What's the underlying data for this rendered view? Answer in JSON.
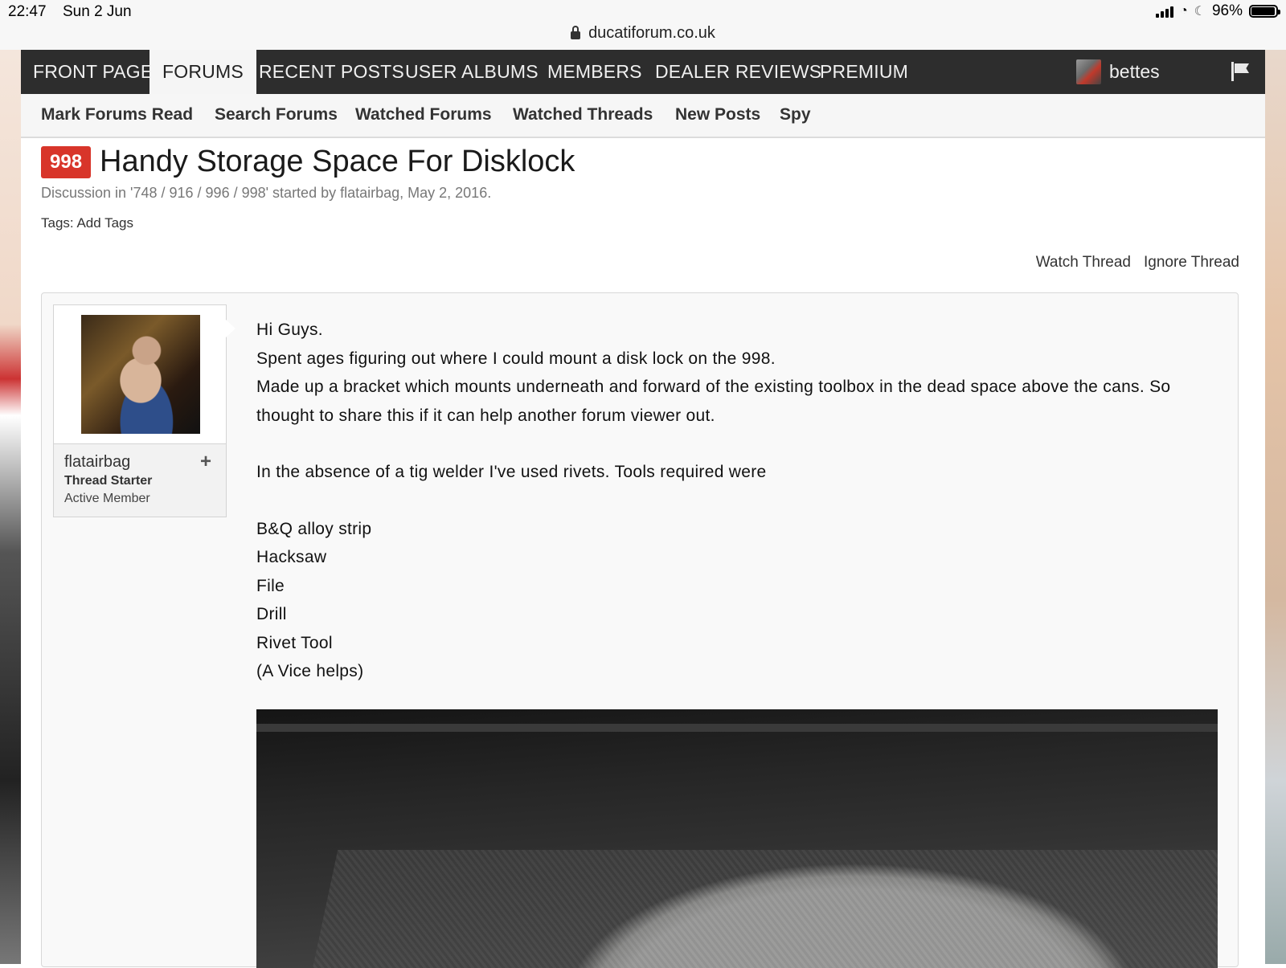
{
  "status_bar": {
    "time": "22:47",
    "date": "Sun 2 Jun",
    "battery": "96%"
  },
  "address_bar": {
    "url": "ducatiforum.co.uk"
  },
  "main_nav": {
    "tabs": [
      {
        "label": "FRONT PAGE"
      },
      {
        "label": "FORUMS"
      },
      {
        "label": "RECENT POSTS"
      },
      {
        "label": "USER ALBUMS"
      },
      {
        "label": "MEMBERS"
      },
      {
        "label": "DEALER REVIEWS"
      },
      {
        "label": "PREMIUM"
      }
    ],
    "active_tab": "FORUMS",
    "username": "bettes"
  },
  "sub_nav": {
    "links": [
      {
        "label": "Mark Forums Read"
      },
      {
        "label": "Search Forums"
      },
      {
        "label": "Watched Forums"
      },
      {
        "label": "Watched Threads"
      },
      {
        "label": "New Posts"
      },
      {
        "label": "Spy"
      }
    ]
  },
  "thread": {
    "prefix": "998",
    "title": "Handy Storage Space For Disklock",
    "meta": "Discussion in '748 / 916 / 996 / 998' started by flatairbag, May 2, 2016.",
    "tags_label": "Tags:",
    "add_tags": "Add Tags",
    "watch": "Watch Thread",
    "ignore": "Ignore Thread"
  },
  "post": {
    "author": "flatairbag",
    "author_status": "Thread Starter",
    "author_rank": "Active Member",
    "lines": [
      "Hi Guys.",
      "Spent ages figuring out where I could mount a disk lock on the 998.",
      "Made up a bracket which mounts underneath and forward of the existing toolbox in the dead space above the cans. So thought to share this if it can help another forum viewer out.",
      "In the absence of a tig welder I've used rivets. Tools required were",
      "B&Q alloy strip",
      "Hacksaw",
      "File",
      "Drill",
      "Rivet Tool",
      "(A Vice helps)"
    ]
  },
  "colors": {
    "nav_bg": "#2d2d2d",
    "prefix_badge": "#d8352a"
  }
}
